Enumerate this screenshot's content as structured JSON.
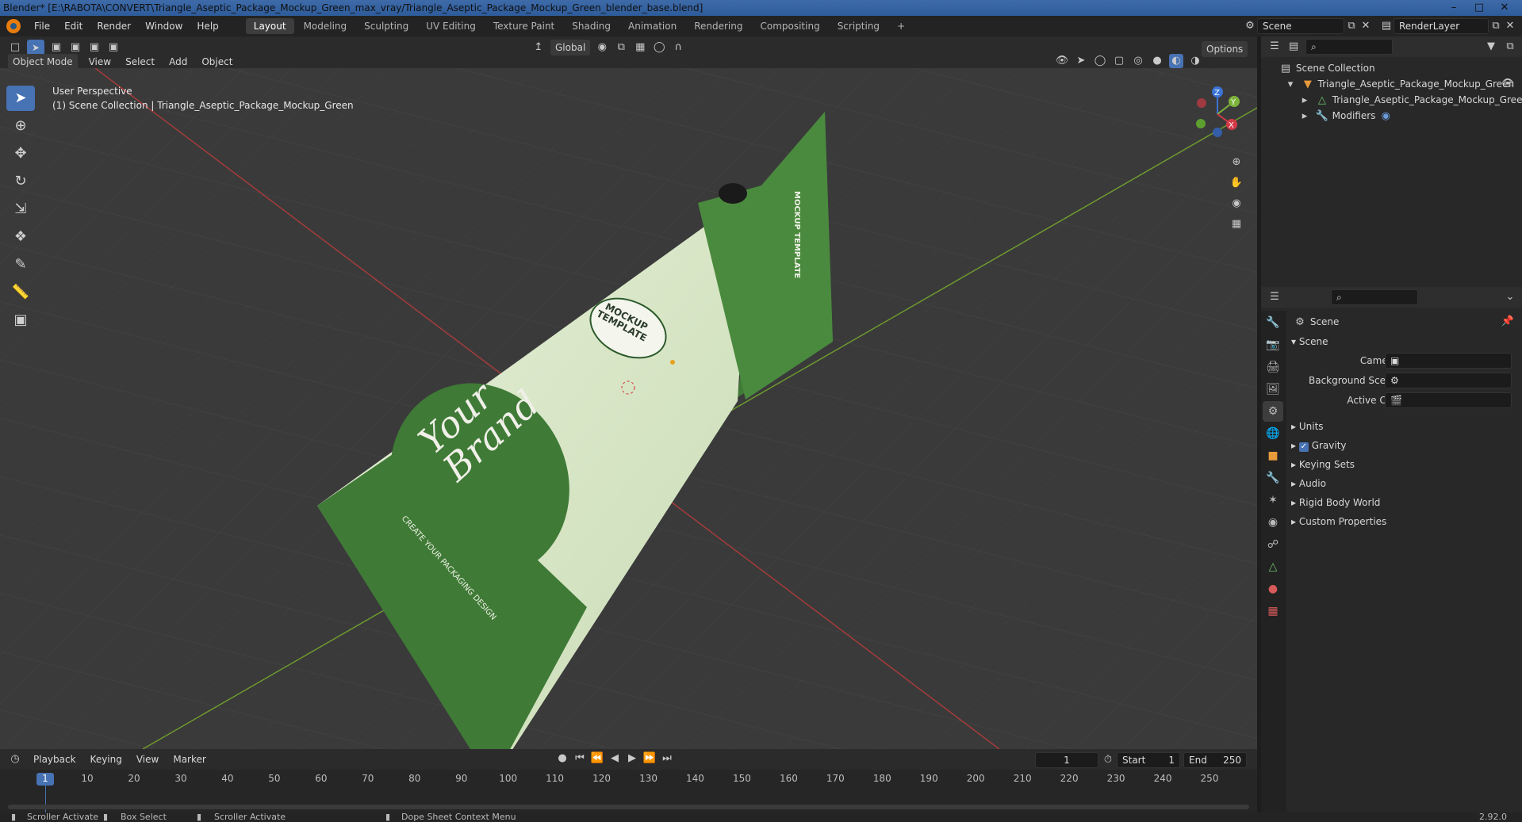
{
  "window": {
    "title": "Blender* [E:\\RABOTA\\CONVERT\\Triangle_Aseptic_Package_Mockup_Green_max_vray/Triangle_Aseptic_Package_Mockup_Green_blender_base.blend]"
  },
  "menu": [
    "File",
    "Edit",
    "Render",
    "Window",
    "Help"
  ],
  "workspaces": [
    "Layout",
    "Modeling",
    "Sculpting",
    "UV Editing",
    "Texture Paint",
    "Shading",
    "Animation",
    "Rendering",
    "Compositing",
    "Scripting"
  ],
  "active_workspace": "Layout",
  "scene_field": "Scene",
  "renderlayer_field": "RenderLayer",
  "vp_header": {
    "transform_orientation": "Global",
    "options_label": "Options",
    "mode": "Object Mode",
    "menus": [
      "View",
      "Select",
      "Add",
      "Object"
    ]
  },
  "viewport": {
    "perspective_label": "User Perspective",
    "collection_label": "(1) Scene Collection | Triangle_Aseptic_Package_Mockup_Green",
    "gizmo_axes": {
      "z": "Z",
      "y": "Y",
      "x": "X"
    }
  },
  "package": {
    "brand_line1": "Your",
    "brand_line2": "Brand",
    "tagline": "CREATE YOUR PACKAGING DESIGN",
    "badge_line1": "MOCKUP",
    "badge_line2": "TEMPLATE",
    "side_text": "MOCKUP TEMPLATE"
  },
  "outliner": {
    "root": "Scene Collection",
    "object": "Triangle_Aseptic_Package_Mockup_Green",
    "mesh": "Triangle_Aseptic_Package_Mockup_Gree",
    "modifiers": "Modifiers"
  },
  "properties": {
    "header": "Scene",
    "section": "Scene",
    "camera_label": "Camera",
    "bgscene_label": "Background Scene",
    "activeclip_label": "Active Clip",
    "panels": [
      "Units",
      "Gravity",
      "Keying Sets",
      "Audio",
      "Rigid Body World",
      "Custom Properties"
    ],
    "gravity_checked": true
  },
  "timeline": {
    "menus": [
      "Playback",
      "Keying",
      "View",
      "Marker"
    ],
    "current_frame": "1",
    "start_label": "Start",
    "start_value": "1",
    "end_label": "End",
    "end_value": "250",
    "ticks": [
      "1",
      "10",
      "20",
      "30",
      "40",
      "50",
      "60",
      "70",
      "80",
      "90",
      "100",
      "110",
      "120",
      "130",
      "140",
      "150",
      "160",
      "170",
      "180",
      "190",
      "200",
      "210",
      "220",
      "230",
      "240",
      "250"
    ]
  },
  "statusbar": {
    "item1": "Scroller Activate",
    "item2": "Box Select",
    "item3": "Scroller Activate",
    "item4": "Dope Sheet Context Menu",
    "version": "2.92.0"
  }
}
